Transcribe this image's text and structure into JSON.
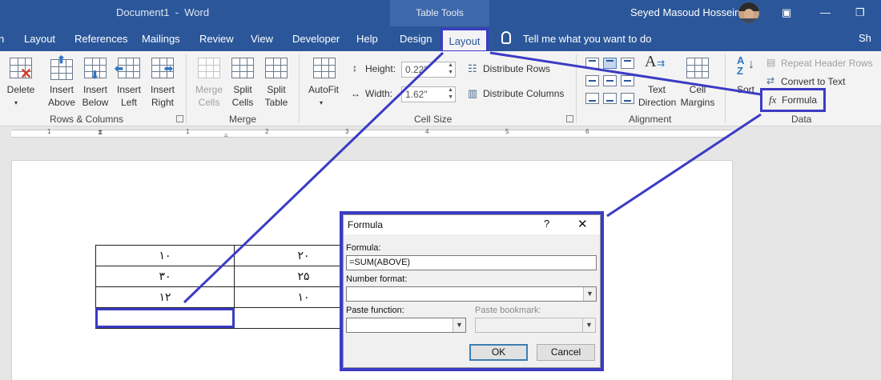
{
  "titlebar": {
    "doc_title": "Document1  -  Word",
    "table_tools": "Table Tools",
    "user": "Seyed Masoud Hosseini",
    "icons": [
      "ribbon-display-options-icon",
      "minimize-icon",
      "restore-icon"
    ]
  },
  "tabs": {
    "items": [
      "Layout",
      "References",
      "Mailings",
      "Review",
      "View",
      "Developer",
      "Help",
      "Design"
    ],
    "active": "Layout",
    "tell_me": "Tell me what you want to do",
    "share": "Sh"
  },
  "ribbon": {
    "rows_columns": {
      "delete": "Delete",
      "insert_above": [
        "Insert",
        "Above"
      ],
      "insert_below": [
        "Insert",
        "Below"
      ],
      "insert_left": [
        "Insert",
        "Left"
      ],
      "insert_right": [
        "Insert",
        "Right"
      ],
      "label": "Rows & Columns"
    },
    "merge": {
      "merge_cells": [
        "Merge",
        "Cells"
      ],
      "split_cells": [
        "Split",
        "Cells"
      ],
      "split_table": [
        "Split",
        "Table"
      ],
      "label": "Merge"
    },
    "cell_size": {
      "autofit": "AutoFit",
      "height_label": "Height:",
      "height_value": "0.22\"",
      "width_label": "Width:",
      "width_value": "1.62\"",
      "distribute_rows": "Distribute Rows",
      "distribute_columns": "Distribute Columns",
      "label": "Cell Size"
    },
    "alignment": {
      "text_direction": [
        "Text",
        "Direction"
      ],
      "cell_margins": [
        "Cell",
        "Margins"
      ],
      "label": "Alignment"
    },
    "data": {
      "sort": "Sort",
      "repeat_header_rows": "Repeat Header Rows",
      "convert_to_text": "Convert to Text",
      "formula": "Formula",
      "label": "Data"
    }
  },
  "ruler": {
    "numbers": [
      "1",
      "1",
      "2",
      "3",
      "4",
      "5",
      "6"
    ]
  },
  "document": {
    "table": [
      [
        "۱۰",
        "۲۰"
      ],
      [
        "۳۰",
        "۲۵"
      ],
      [
        "۱۲",
        "۱۰"
      ],
      [
        "",
        ""
      ]
    ]
  },
  "dialog": {
    "title": "Formula",
    "help": "?",
    "close": "✕",
    "formula_label": "Formula:",
    "formula_value": "=SUM(ABOVE)",
    "number_format_label": "Number format:",
    "number_format_value": "",
    "paste_function_label": "Paste function:",
    "paste_bookmark_label": "Paste bookmark:",
    "ok": "OK",
    "cancel": "Cancel"
  },
  "colors": {
    "word_blue": "#2b579a",
    "highlight": "#3b3bc4"
  }
}
